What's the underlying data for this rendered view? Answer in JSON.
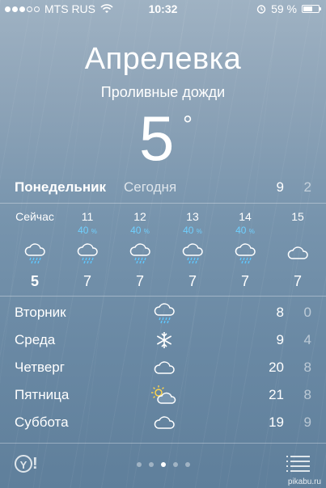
{
  "status": {
    "carrier": "MTS RUS",
    "time": "10:32",
    "battery": "59 %",
    "signal_bars_filled": 3,
    "signal_bars_total": 5
  },
  "location": {
    "city": "Апрелевка",
    "condition": "Проливные дожди",
    "temp": "5",
    "deg": "°"
  },
  "today": {
    "day": "Понедельник",
    "label": "Сегодня",
    "hi": "9",
    "lo": "2"
  },
  "hourly": [
    {
      "time": "Сейчас",
      "prob": "",
      "icon": "rain-cloud-icon",
      "temp": "5",
      "bold": true
    },
    {
      "time": "11",
      "prob": "40",
      "icon": "rain-cloud-icon",
      "temp": "7"
    },
    {
      "time": "12",
      "prob": "40",
      "icon": "rain-cloud-icon",
      "temp": "7"
    },
    {
      "time": "13",
      "prob": "40",
      "icon": "rain-cloud-icon",
      "temp": "7"
    },
    {
      "time": "14",
      "prob": "40",
      "icon": "rain-cloud-icon",
      "temp": "7"
    },
    {
      "time": "15",
      "prob": "",
      "icon": "cloud-icon",
      "temp": "7"
    }
  ],
  "percent_sign": "%",
  "daily": [
    {
      "name": "Вторник",
      "icon": "rain-cloud-icon",
      "hi": "8",
      "lo": "0"
    },
    {
      "name": "Среда",
      "icon": "snowflake-icon",
      "hi": "9",
      "lo": "4"
    },
    {
      "name": "Четверг",
      "icon": "cloud-icon",
      "hi": "20",
      "lo": "8"
    },
    {
      "name": "Пятница",
      "icon": "sun-cloud-icon",
      "hi": "21",
      "lo": "8"
    },
    {
      "name": "Суббота",
      "icon": "cloud-icon",
      "hi": "19",
      "lo": "9"
    }
  ],
  "footer": {
    "yahoo_letter": "Y",
    "yahoo_mark": "!",
    "pages": 5,
    "active_page": 3,
    "watermark": "pikabu.ru"
  }
}
